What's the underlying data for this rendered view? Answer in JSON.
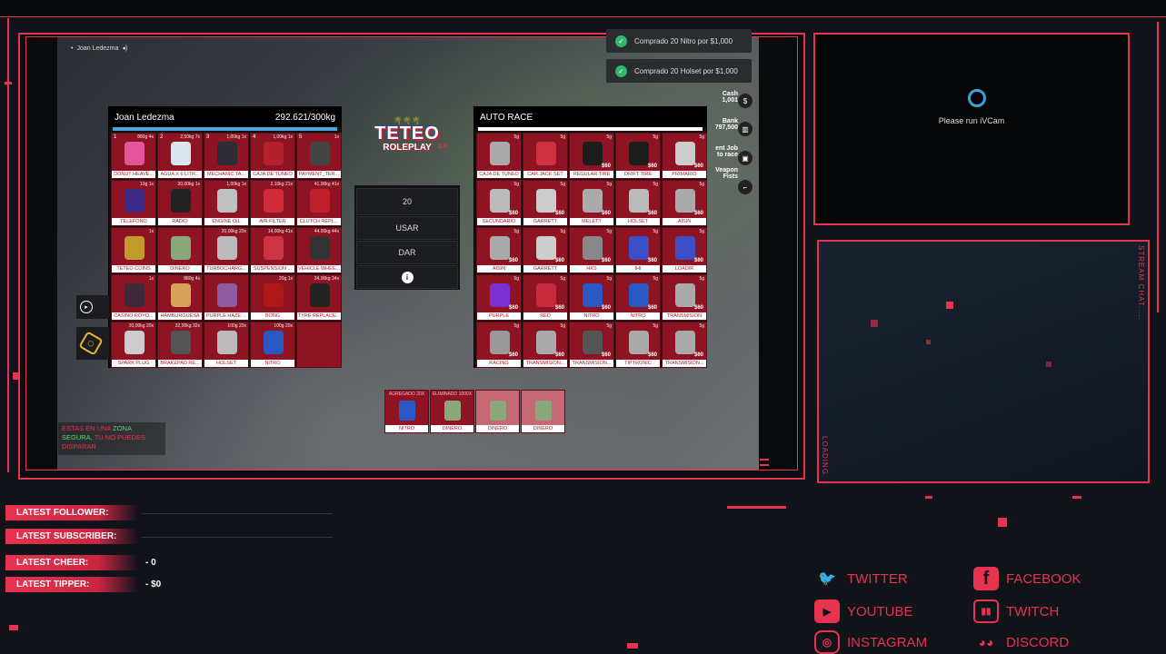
{
  "player": {
    "name": "Joan Ledezma",
    "name2": "Joan Ledezma",
    "weight": "292.621/300kg"
  },
  "shop": {
    "title": "AUTO RACE"
  },
  "logo": {
    "line1": "TETEO",
    "line2": "ROLEPLAY",
    "badge": "2.0"
  },
  "middle": {
    "quantity": "20",
    "use": "USAR",
    "give": "DAR"
  },
  "notifications": [
    "Comprado 20 Nitro por $1,000",
    "Comprado 20 Holset por $1,000"
  ],
  "hud": {
    "cash_label": "Cash",
    "cash": "1,001",
    "bank_label": "Bank",
    "bank": "797,500",
    "job": "ent Job",
    "job2": "to race",
    "weapon": "Veapon",
    "weapon2": "Fists"
  },
  "safezone": {
    "line1a": "ESTAS EN UNA",
    "line1b": "ZONA",
    "line2a": "SEGURA,",
    "line2b": "TU NO PUEDES",
    "line3": "DISPARAR"
  },
  "inventory": [
    {
      "n": "1",
      "w": "880g",
      "q": "4x",
      "label": "DONUT HEAVE...",
      "color": "#e2559a"
    },
    {
      "n": "2",
      "w": "2,50kg",
      "q": "7x",
      "label": "AGUA X 6 LITR...",
      "color": "#d9e6f0"
    },
    {
      "n": "3",
      "w": "1,00kg",
      "q": "1x",
      "label": "MECHANIC TA...",
      "color": "#2d2d36"
    },
    {
      "n": "4",
      "w": "1,00kg",
      "q": "1x",
      "label": "CAJA DE TUNEO",
      "color": "#b3202e"
    },
    {
      "n": "5",
      "w": "",
      "q": "1x",
      "label": "PAYMENT_TER...",
      "color": "#444"
    },
    {
      "n": "",
      "w": "10g",
      "q": "1x",
      "label": "TELEFONO",
      "color": "#3b2a86"
    },
    {
      "n": "",
      "w": "20,00kg",
      "q": "1x",
      "label": "RADIO",
      "color": "#222"
    },
    {
      "n": "",
      "w": "1,00kg",
      "q": "1x",
      "label": "ENGINE OIL",
      "color": "#bfbfbf"
    },
    {
      "n": "",
      "w": "2,10kg",
      "q": "21x",
      "label": "AIR FILTER",
      "color": "#d22b3a"
    },
    {
      "n": "",
      "w": "41,00kg",
      "q": "41x",
      "label": "CLUTCH REPL...",
      "color": "#c21f2d"
    },
    {
      "n": "",
      "w": "",
      "q": "1x",
      "label": "TETEO COINS",
      "color": "#c49a2c"
    },
    {
      "n": "",
      "w": "",
      "q": "",
      "label": "DINERO",
      "color": "#8aa77a"
    },
    {
      "n": "",
      "w": "20,00kg",
      "q": "20x",
      "label": "TURBOCHARG...",
      "color": "#bbb"
    },
    {
      "n": "",
      "w": "14,00kg",
      "q": "41x",
      "label": "SUSPENSION ...",
      "color": "#cc3443"
    },
    {
      "n": "",
      "w": "44,00kg",
      "q": "44x",
      "label": "VEHICLE WHEE...",
      "color": "#333"
    },
    {
      "n": "",
      "w": "",
      "q": "1x",
      "label": "CASINO ROYO...",
      "color": "#3a2a3a"
    },
    {
      "n": "",
      "w": "880g",
      "q": "4x",
      "label": "HAMBURGUESA",
      "color": "#d9a25a"
    },
    {
      "n": "",
      "w": "",
      "q": "",
      "label": "PURPLE HAZE ...",
      "color": "#8e5aa0"
    },
    {
      "n": "",
      "w": "20g",
      "q": "1x",
      "label": "BONG",
      "color": "#b01818"
    },
    {
      "n": "",
      "w": "34,00kg",
      "q": "34x",
      "label": "TYRE REPLACE...",
      "color": "#222"
    },
    {
      "n": "",
      "w": "20,00kg",
      "q": "20x",
      "label": "SPARK PLUG",
      "color": "#ccc"
    },
    {
      "n": "",
      "w": "32,00kg",
      "q": "32x",
      "label": "BRAKEPAD RE...",
      "color": "#555"
    },
    {
      "n": "",
      "w": "100g",
      "q": "20x",
      "label": "HOLSET",
      "color": "#bbb"
    },
    {
      "n": "",
      "w": "100g",
      "q": "20x",
      "label": "NITRO",
      "color": "#2958c4"
    }
  ],
  "shop_items": [
    {
      "w": "5g",
      "label": "CAJA DE TUNEO",
      "price": "",
      "color": "#aaa"
    },
    {
      "w": "5g",
      "label": "CAR JACK SET",
      "price": "",
      "color": "#d0313f"
    },
    {
      "w": "5g",
      "label": "REGULAR TIRE",
      "price": "$60",
      "color": "#1c1c1c"
    },
    {
      "w": "5g",
      "label": "DRIFT TIRE",
      "price": "$60",
      "color": "#1c1c1c"
    },
    {
      "w": "5g",
      "label": "PRIMARIO",
      "price": "$60",
      "color": "#ccc"
    },
    {
      "w": "5g",
      "label": "SECUNDARIO",
      "price": "$60",
      "color": "#bbb"
    },
    {
      "w": "5g",
      "label": "GARRETT",
      "price": "$60",
      "color": "#ccc"
    },
    {
      "w": "5g",
      "label": "MELETT",
      "price": "$60",
      "color": "#aaa"
    },
    {
      "w": "5g",
      "label": "HOLSET",
      "price": "$60",
      "color": "#bbb"
    },
    {
      "w": "5g",
      "label": "AISIN",
      "price": "$60",
      "color": "#aaa"
    },
    {
      "w": "5g",
      "label": "AISIN",
      "price": "$60",
      "color": "#aaa"
    },
    {
      "w": "5g",
      "label": "GARRETT",
      "price": "$60",
      "color": "#ccc"
    },
    {
      "w": "5g",
      "label": "HKS",
      "price": "$60",
      "color": "#888"
    },
    {
      "w": "5g",
      "label": "IHI",
      "price": "$60",
      "color": "#3d4fc7"
    },
    {
      "w": "5g",
      "label": "LOADIR",
      "price": "$60",
      "color": "#3d4fc7"
    },
    {
      "w": "5g",
      "label": "PURPLE",
      "price": "$60",
      "color": "#7a2fd0"
    },
    {
      "w": "5g",
      "label": "RED",
      "price": "$60",
      "color": "#c72a3c"
    },
    {
      "w": "5g",
      "label": "NITRO",
      "price": "$60",
      "color": "#2958c4"
    },
    {
      "w": "5g",
      "label": "NITRO",
      "price": "$60",
      "color": "#2958c4"
    },
    {
      "w": "5g",
      "label": "TRANSMISION",
      "price": "$60",
      "color": "#aaa"
    },
    {
      "w": "5g",
      "label": "RACING",
      "price": "$60",
      "color": "#999"
    },
    {
      "w": "5g",
      "label": "TRANSMISION...",
      "price": "$60",
      "color": "#aaa"
    },
    {
      "w": "5g",
      "label": "TRANSMISION...",
      "price": "$60",
      "color": "#555"
    },
    {
      "w": "5g",
      "label": "TIPTRONIC",
      "price": "$60",
      "color": "#aaa"
    },
    {
      "w": "5g",
      "label": "TRANSMISION...",
      "price": "$60",
      "color": "#aaa"
    }
  ],
  "hotbar": [
    {
      "head": "AGREGADO 20X",
      "label": "NITRO",
      "color": "#2958c4"
    },
    {
      "head": "ELIMINADO 1000X",
      "label": "DINERO",
      "color": "#8aa77a"
    },
    {
      "head": "",
      "label": "DINERO",
      "color": "#8aa77a"
    },
    {
      "head": "",
      "label": "DINERO",
      "color": "#8aa77a"
    }
  ],
  "webcam": {
    "text": "Please run iVCam"
  },
  "chat": {
    "label": "STREAM CHAT.....",
    "loading": "LOADING"
  },
  "stats": {
    "follower": "LATEST FOLLOWER:",
    "subscriber": "LATEST SUBSCRIBER:",
    "cheer": "LATEST CHEER:",
    "cheer_val": "- 0",
    "tipper": "LATEST TIPPER:",
    "tipper_val": "- $0"
  },
  "socials": [
    "TWITTER",
    "FACEBOOK",
    "YOUTUBE",
    "TWITCH",
    "INSTAGRAM",
    "DISCORD"
  ],
  "colors": {
    "accent": "#e8334f",
    "slot": "#8e1424"
  }
}
